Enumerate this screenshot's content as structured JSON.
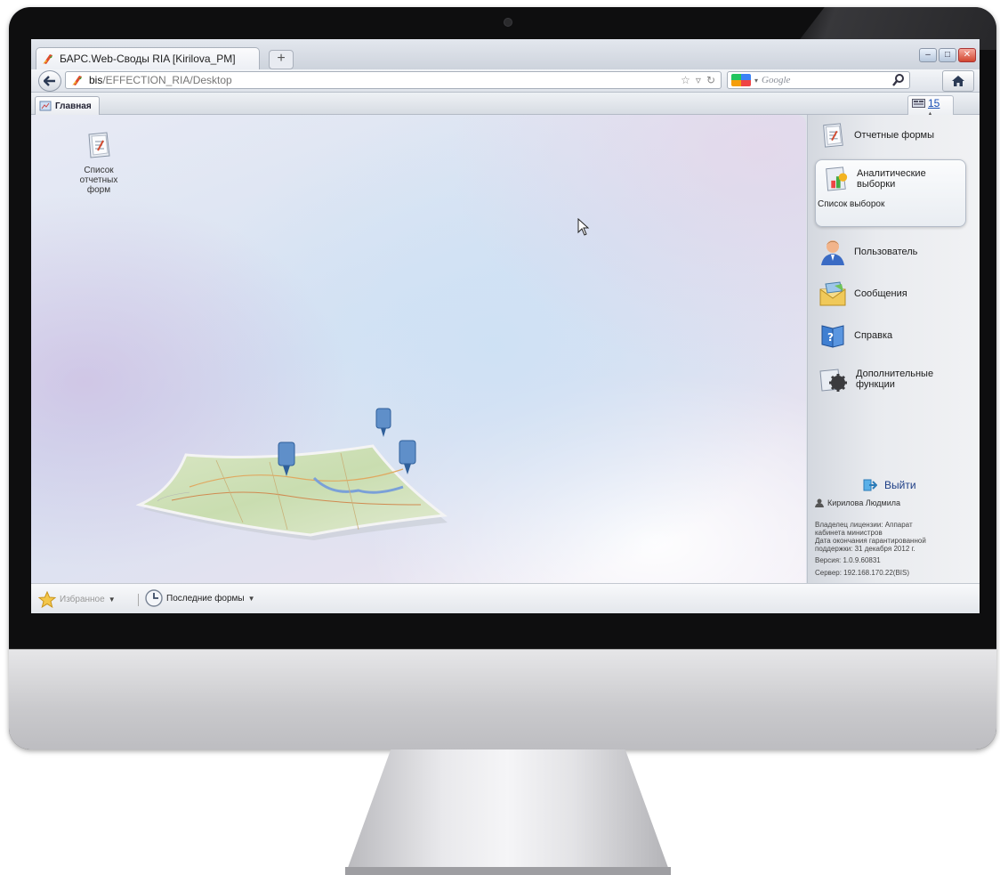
{
  "browser": {
    "tab_title": "БАРС.Web-Своды RIA [Kirilova_PM]",
    "new_tab_symbol": "+",
    "url_host": "bis",
    "url_path": "/EFFECTION_RIA/Desktop",
    "search_placeholder": "Google",
    "window_buttons": [
      "–",
      "□",
      "✕"
    ]
  },
  "app": {
    "main_tab": "Главная",
    "notification_count": "15",
    "desktop_icons": [
      {
        "label_lines": [
          "Список",
          "отчетных",
          "форм"
        ],
        "icon": "report-forms-icon"
      }
    ],
    "right_panel": {
      "items": [
        {
          "label": "Отчетные формы",
          "icon": "report-forms-icon"
        },
        {
          "label_lines": [
            "Аналитические",
            "выборки"
          ],
          "icon": "analytics-icon",
          "sub": "Список выборок"
        },
        {
          "label": "Пользователь",
          "icon": "user-icon"
        },
        {
          "label": "Сообщения",
          "icon": "messages-icon"
        },
        {
          "label": "Справка",
          "icon": "help-icon"
        },
        {
          "label_lines": [
            "Дополнительные",
            "функции"
          ],
          "icon": "gear-icon"
        }
      ],
      "logout": "Выйти",
      "user_name": "Кирилова Людмила",
      "license_lines": [
        "Владелец лицензии: Аппарат",
        "кабинета министров",
        "Дата окончания гарантированной",
        "поддержки: 31 декабря 2012 г."
      ],
      "version": "Версия: 1.0.9.60831",
      "server": "Сервер: 192.168.170.22(BIS)"
    },
    "bottom_bar": {
      "favorites": "Избранное",
      "recent_forms": "Последние формы"
    }
  },
  "colors": {
    "accent_link": "#1a4fb5",
    "bezel": "#0e0e0f",
    "close_button": "#d1452f"
  }
}
